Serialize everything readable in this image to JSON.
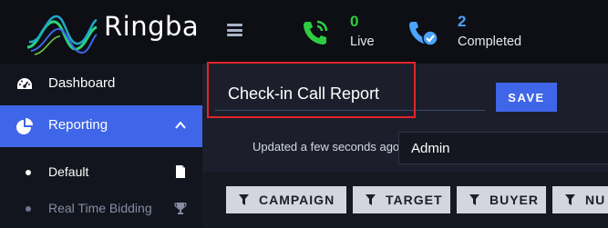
{
  "brand": {
    "name": "Ringba"
  },
  "header": {
    "menu_icon": "hamburger-icon",
    "stats": [
      {
        "count": "0",
        "label": "Live",
        "icon": "phone-ringing-icon",
        "color": "#2ecc40"
      },
      {
        "count": "2",
        "label": "Completed",
        "icon": "phone-check-icon",
        "color": "#4aa3ff"
      }
    ]
  },
  "sidebar": {
    "items": [
      {
        "label": "Dashboard",
        "icon": "dashboard-gauge-icon"
      },
      {
        "label": "Reporting",
        "icon": "pie-chart-icon",
        "active": true,
        "expanded": true
      }
    ],
    "subitems": [
      {
        "label": "Default",
        "icon": "document-icon"
      },
      {
        "label": "Real Time Bidding",
        "icon": "trophy-icon"
      }
    ]
  },
  "report": {
    "title_value": "Check-in Call Report",
    "save_label": "SAVE",
    "updated_text": "Updated a few seconds ago",
    "user_selected": "Admin"
  },
  "filters": [
    "CAMPAIGN",
    "TARGET",
    "BUYER",
    "NU"
  ],
  "colors": {
    "accent": "#3f66e8",
    "highlight": "#e3242b",
    "live": "#2ecc40",
    "completed": "#4aa3ff"
  }
}
